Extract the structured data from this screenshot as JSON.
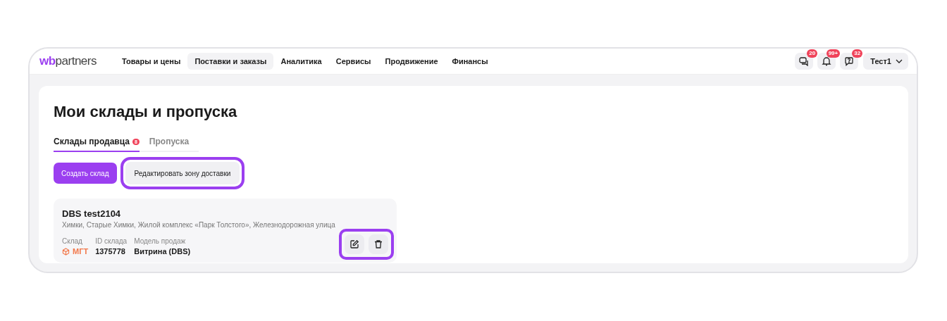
{
  "logo": {
    "brand": "wb",
    "name": "partners"
  },
  "nav": [
    {
      "label": "Товары и цены",
      "selected": false
    },
    {
      "label": "Поставки и заказы",
      "selected": true
    },
    {
      "label": "Аналитика",
      "selected": false
    },
    {
      "label": "Сервисы",
      "selected": false
    },
    {
      "label": "Продвижение",
      "selected": false
    },
    {
      "label": "Финансы",
      "selected": false
    }
  ],
  "header_actions": [
    {
      "kind": "chat",
      "badge": "20"
    },
    {
      "kind": "bell",
      "badge": "99+"
    },
    {
      "kind": "help",
      "badge": "32"
    }
  ],
  "user_menu": {
    "label": "Тест1"
  },
  "page_title": "Мои склады и пропуска",
  "tabs": [
    {
      "label": "Склады продавца",
      "badge": "8",
      "selected": true
    },
    {
      "label": "Пропуска",
      "selected": false
    }
  ],
  "buttons": [
    {
      "label": "Создать склад",
      "kind": "primary",
      "highlighted": false
    },
    {
      "label": "Редактировать зону доставки",
      "kind": "secondary",
      "highlighted": true
    }
  ],
  "warehouse": {
    "name": "DBS test2104",
    "address": "Химки, Старые Химки, Жилой комплекс «Парк Толстого», Железнодорожная улица",
    "fields": [
      {
        "label": "Склад",
        "value": "МГТ",
        "kind": "tag"
      },
      {
        "label": "ID склада",
        "value": "1375778",
        "kind": "plain"
      },
      {
        "label": "Модель продаж",
        "value": "Витрина (DBS)",
        "kind": "plain"
      }
    ],
    "actions": [
      {
        "kind": "edit"
      },
      {
        "kind": "delete"
      }
    ],
    "actions_highlighted": true
  }
}
